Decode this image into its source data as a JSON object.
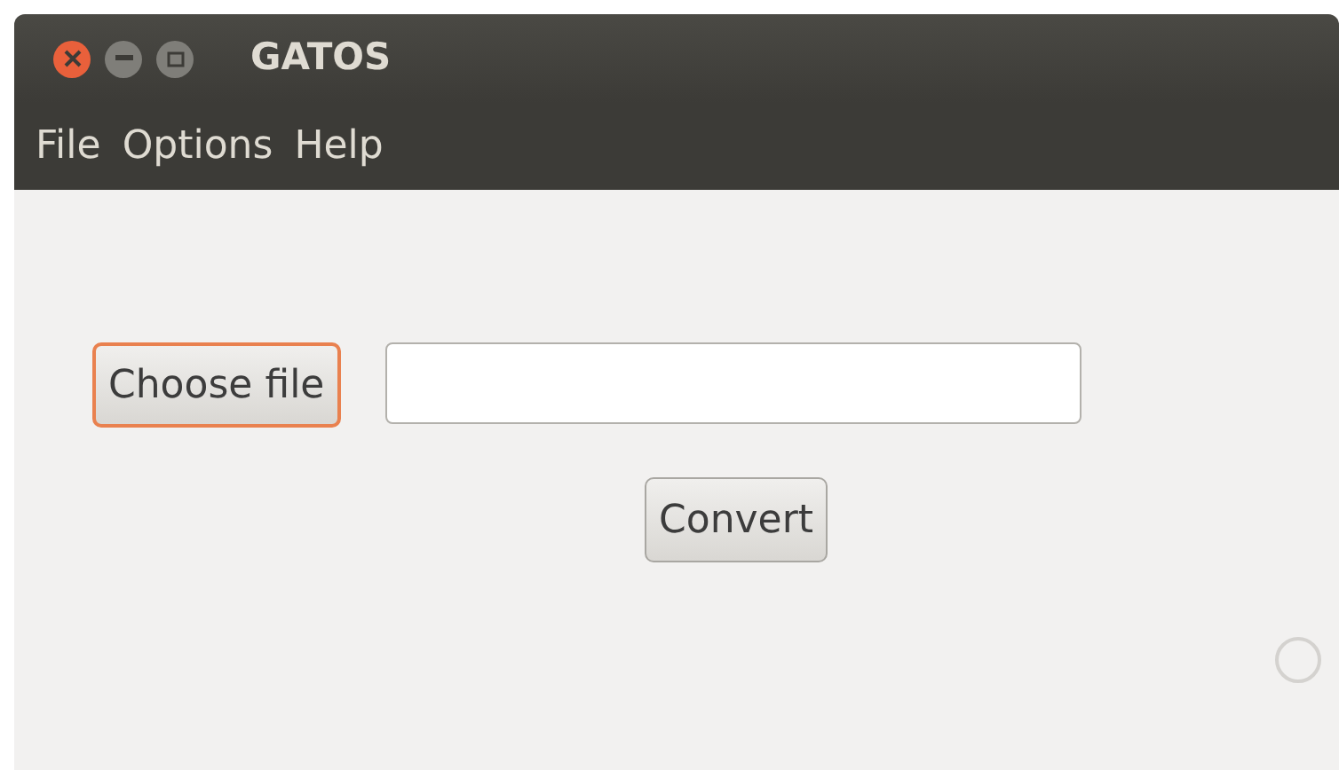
{
  "window": {
    "title": "GATOS"
  },
  "menu": [
    "File",
    "Options",
    "Help"
  ],
  "choose_button": {
    "label": "Choose file",
    "focused": true
  },
  "convert_button": {
    "label": "Convert"
  }
}
